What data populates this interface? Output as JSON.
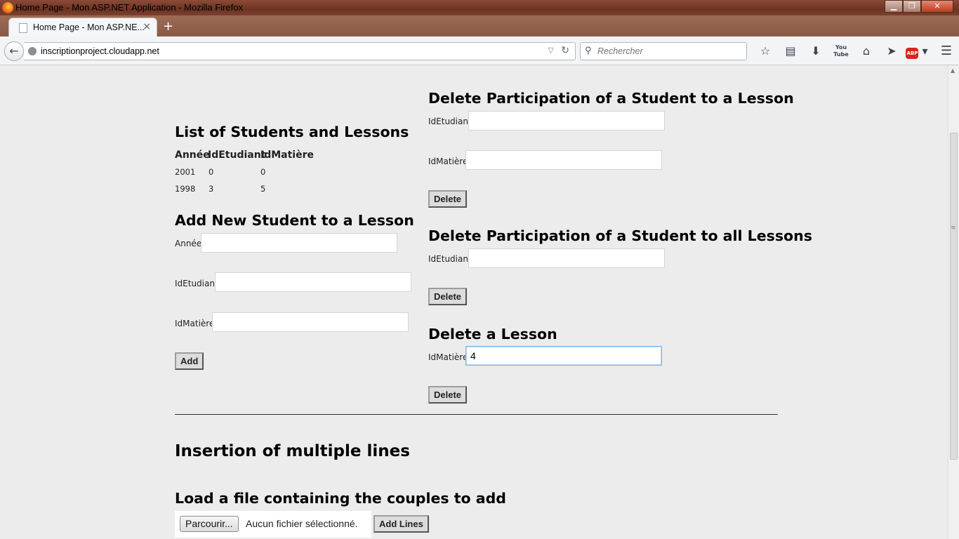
{
  "window": {
    "title": "Home Page - Mon ASP.NET Application - Mozilla Firefox",
    "minimize": "▁",
    "maximize": "❐",
    "close": "✕"
  },
  "tab": {
    "title": "Home Page - Mon ASP.NE...",
    "close": "×",
    "new_tab": "+"
  },
  "navbar": {
    "back": "←",
    "url": "inscriptionproject.cloudapp.net",
    "dropdown": "▽",
    "reload": "↻",
    "search_placeholder": "Rechercher",
    "icons": [
      "star-icon",
      "reading-list-icon",
      "download-icon",
      "youtube-icon",
      "home-icon",
      "send-icon",
      "adblock-icon",
      "menu-icon"
    ]
  },
  "list_section": {
    "title": "List of Students and Lessons",
    "columns": [
      "Année",
      "IdEtudiant",
      "IdMatière"
    ],
    "rows": [
      [
        "2001",
        "0",
        "0"
      ],
      [
        "1998",
        "3",
        "5"
      ]
    ]
  },
  "add_section": {
    "title": "Add New Student to a Lesson",
    "annee_label": "Année",
    "annee_value": "",
    "etudiant_label": "IdEtudiant",
    "etudiant_value": "",
    "matiere_label": "IdMatière",
    "matiere_value": "",
    "button": "Add"
  },
  "delete_participation": {
    "title": "Delete Participation of a Student to a Lesson",
    "etudiant_label": "IdEtudiant",
    "etudiant_value": "",
    "matiere_label": "IdMatière",
    "matiere_value": "",
    "button": "Delete"
  },
  "delete_all": {
    "title": "Delete Participation of a Student to all Lessons",
    "etudiant_label": "IdEtudiant",
    "etudiant_value": "",
    "button": "Delete"
  },
  "delete_lesson": {
    "title": "Delete a Lesson",
    "matiere_label": "IdMatière",
    "matiere_value": "4",
    "button": "Delete"
  },
  "multiple": {
    "title": "Insertion of multiple lines",
    "load_title": "Load a file containing the couples to add",
    "browse_button": "Parcourir...",
    "file_status": "Aucun fichier sélectionné.",
    "add_lines_button": "Add Lines"
  }
}
